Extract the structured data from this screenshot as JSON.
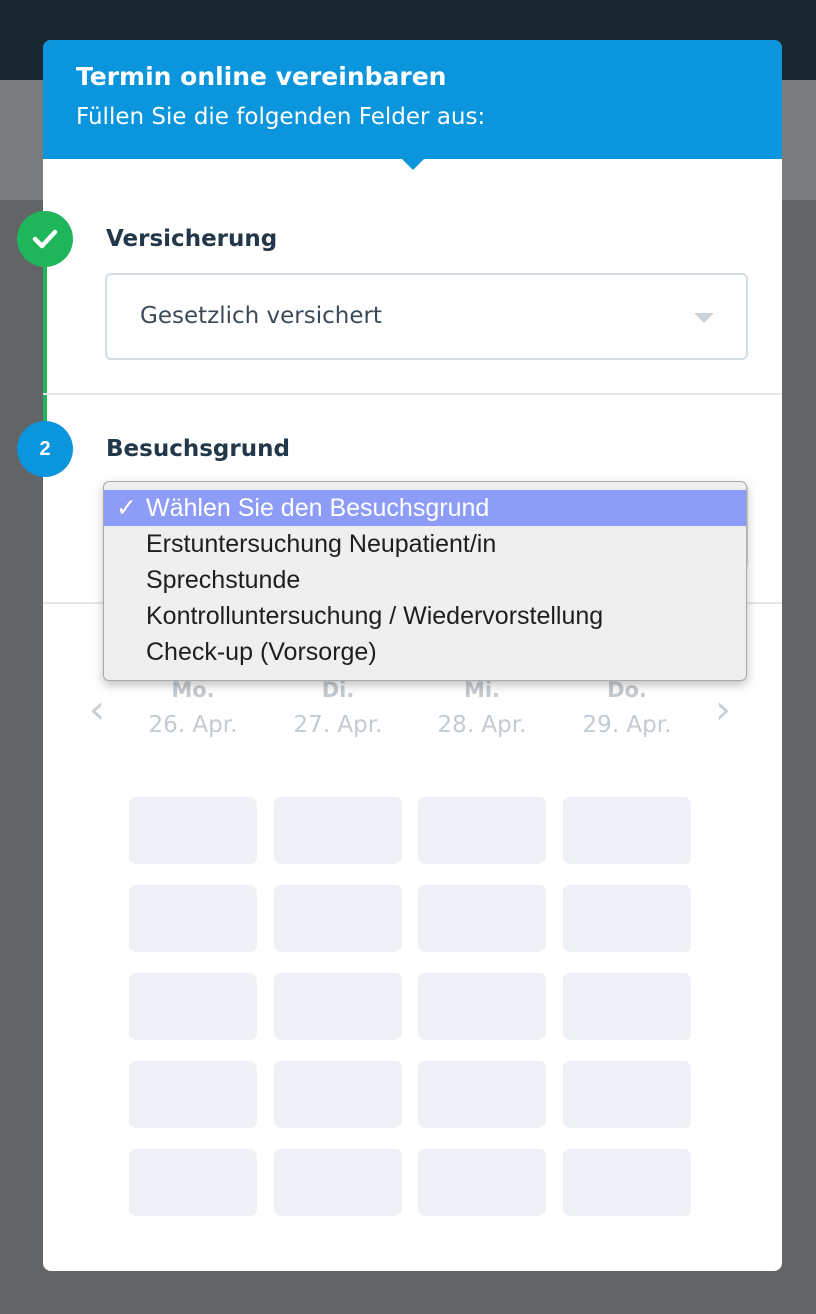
{
  "header": {
    "title": "Termin online vereinbaren",
    "subtitle": "Füllen Sie die folgenden Felder aus:"
  },
  "steps": [
    {
      "icon": "checkmark-icon",
      "label": "Versicherung",
      "value": "Gesetzlich versichert",
      "status": "done"
    },
    {
      "number": "2",
      "label": "Besuchsgrund",
      "status": "active"
    }
  ],
  "dropdown": {
    "selected_index": 0,
    "options": [
      "Wählen Sie den Besuchsgrund",
      "Erstuntersuchung Neupatient/in",
      "Sprechstunde",
      "Kontrolluntersuchung / Wiedervorstellung",
      "Check-up (Vorsorge)"
    ]
  },
  "calendar": {
    "days": [
      {
        "weekday": "Mo.",
        "date": "26. Apr."
      },
      {
        "weekday": "Di.",
        "date": "27. Apr."
      },
      {
        "weekday": "Mi.",
        "date": "28. Apr."
      },
      {
        "weekday": "Do.",
        "date": "29. Apr."
      }
    ],
    "prev_icon": "chevron-left-icon",
    "next_icon": "chevron-right-icon"
  },
  "colors": {
    "primary": "#0a95dd",
    "success": "#1fb55b",
    "highlight": "#8c9cf7"
  }
}
